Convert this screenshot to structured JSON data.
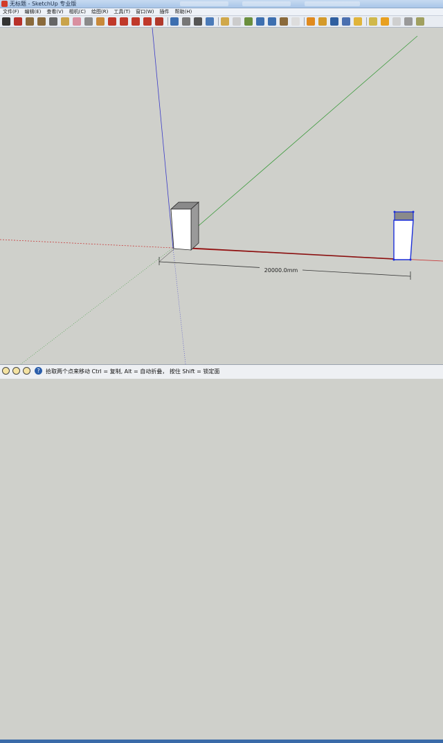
{
  "window": {
    "title": "无标题 - SketchUp 专业版"
  },
  "menu": [
    {
      "id": "file",
      "label": "文件(F)"
    },
    {
      "id": "edit",
      "label": "编辑(E)"
    },
    {
      "id": "view",
      "label": "查看(V)"
    },
    {
      "id": "camera",
      "label": "相机(C)"
    },
    {
      "id": "draw",
      "label": "绘图(R)"
    },
    {
      "id": "tools",
      "label": "工具(T)"
    },
    {
      "id": "window",
      "label": "窗口(W)"
    },
    {
      "id": "plugins",
      "label": "插件"
    },
    {
      "id": "help",
      "label": "帮助(H)"
    }
  ],
  "toolbar": {
    "tools": [
      {
        "name": "select-tool-icon",
        "color": "#333333"
      },
      {
        "name": "line-tool-icon",
        "color": "#b8312a"
      },
      {
        "name": "rectangle-tool-icon",
        "color": "#8a6a3c"
      },
      {
        "name": "circle-tool-icon",
        "color": "#8a6a3c"
      },
      {
        "name": "arc-tool-icon",
        "color": "#666666"
      },
      {
        "name": "make-component-icon",
        "color": "#c9a34a"
      },
      {
        "name": "eraser-tool-icon",
        "color": "#d98fa0"
      },
      {
        "name": "tape-measure-icon",
        "color": "#8a8a8a"
      },
      {
        "name": "paint-bucket-icon",
        "color": "#c8893a"
      },
      {
        "name": "push-pull-icon",
        "color": "#c0392b"
      },
      {
        "name": "move-tool-icon",
        "color": "#c0392b"
      },
      {
        "name": "rotate-tool-icon",
        "color": "#c0392b"
      },
      {
        "name": "follow-me-icon",
        "color": "#c0392b"
      },
      {
        "name": "offset-tool-icon",
        "color": "#b0392b"
      },
      {
        "name": "orbit-tool-icon",
        "color": "#3d6fb0"
      },
      {
        "name": "pan-tool-icon",
        "color": "#777777"
      },
      {
        "name": "zoom-tool-icon",
        "color": "#555555"
      },
      {
        "name": "zoom-extents-icon",
        "color": "#4a7ab8"
      },
      {
        "name": "add-location-icon",
        "color": "#d0a84a"
      },
      {
        "name": "toggle-terrain-icon",
        "color": "#cccccc"
      },
      {
        "name": "get-models-icon",
        "color": "#6a8f3e"
      },
      {
        "name": "share-model-icon",
        "color": "#3d6fb0"
      },
      {
        "name": "share-component-icon",
        "color": "#3d6fb0"
      },
      {
        "name": "extension-warehouse-icon",
        "color": "#8a6a3c"
      },
      {
        "name": "photo-textures-icon",
        "color": "#dddddd"
      },
      {
        "name": "style-xray-icon",
        "color": "#e08a1e"
      },
      {
        "name": "style-wireframe-icon",
        "color": "#d49a2a"
      },
      {
        "name": "style-hidden-line-icon",
        "color": "#2f5fa0"
      },
      {
        "name": "style-shaded-icon",
        "color": "#4a6fb0"
      },
      {
        "name": "style-textures-icon",
        "color": "#e0b43a"
      },
      {
        "name": "section-plane-icon",
        "color": "#d0b84a"
      },
      {
        "name": "sun-shadows-icon",
        "color": "#e8a020"
      },
      {
        "name": "fog-icon",
        "color": "#cfcfcf"
      },
      {
        "name": "scenes-icon",
        "color": "#999999"
      },
      {
        "name": "sandbox-icon",
        "color": "#a0a060"
      }
    ]
  },
  "viewport": {
    "measurement_label": "20000.0mm",
    "colors": {
      "background": "#cfd0cb",
      "red_axis": "#c83a3a",
      "green_axis": "#3a9a3a",
      "blue_axis": "#3a3ac8",
      "selection": "#1a2dd8",
      "box_top": "#8a8a8a",
      "box_front": "#ffffff",
      "box_side": "#9a9a9a",
      "dimension_line": "#333333",
      "edge_highlight": "#8a1010"
    }
  },
  "status": {
    "message": "拾取两个点来移动 Ctrl = 复制, Alt = 自动折叠， 按住 Shift = 锁定面"
  }
}
